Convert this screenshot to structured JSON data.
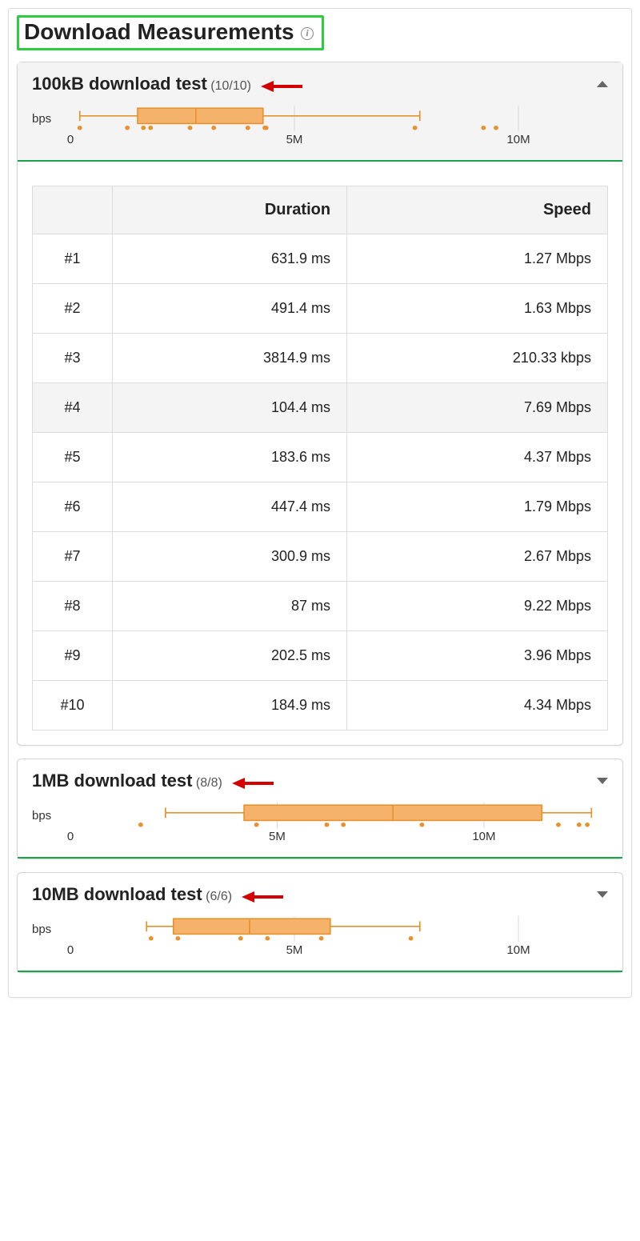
{
  "title": "Download Measurements",
  "tests": [
    {
      "title": "100kB download test",
      "count": "(10/10)",
      "expanded": true,
      "chart": {
        "ylabel": "bps",
        "ticks": [
          "0",
          "5M",
          "10M"
        ],
        "axis_max": 12,
        "box": {
          "low": 0.21,
          "q1": 1.5,
          "median": 2.8,
          "q3": 4.3,
          "high": 7.8
        },
        "points": [
          0.21,
          1.27,
          1.63,
          1.79,
          2.67,
          3.2,
          3.96,
          4.34,
          4.37,
          7.69,
          9.22,
          9.5
        ]
      },
      "table": {
        "columns": [
          "",
          "Duration",
          "Speed"
        ],
        "highlight_row": 3,
        "rows": [
          [
            "#1",
            "631.9 ms",
            "1.27 Mbps"
          ],
          [
            "#2",
            "491.4 ms",
            "1.63 Mbps"
          ],
          [
            "#3",
            "3814.9 ms",
            "210.33 kbps"
          ],
          [
            "#4",
            "104.4 ms",
            "7.69 Mbps"
          ],
          [
            "#5",
            "183.6 ms",
            "4.37 Mbps"
          ],
          [
            "#6",
            "447.4 ms",
            "1.79 Mbps"
          ],
          [
            "#7",
            "300.9 ms",
            "2.67 Mbps"
          ],
          [
            "#8",
            "87 ms",
            "9.22 Mbps"
          ],
          [
            "#9",
            "202.5 ms",
            "3.96 Mbps"
          ],
          [
            "#10",
            "184.9 ms",
            "4.34 Mbps"
          ]
        ]
      }
    },
    {
      "title": "1MB download test",
      "count": "(8/8)",
      "expanded": false,
      "chart": {
        "ylabel": "bps",
        "ticks": [
          "0",
          "5M",
          "10M"
        ],
        "axis_max": 13,
        "box": {
          "low": 2.3,
          "q1": 4.2,
          "median": 7.8,
          "q3": 11.4,
          "high": 12.6
        },
        "points": [
          1.7,
          4.5,
          6.2,
          6.6,
          8.5,
          11.8,
          12.3,
          12.5
        ]
      }
    },
    {
      "title": "10MB download test",
      "count": "(6/6)",
      "expanded": false,
      "chart": {
        "ylabel": "bps",
        "ticks": [
          "0",
          "5M",
          "10M"
        ],
        "axis_max": 12,
        "box": {
          "low": 1.7,
          "q1": 2.3,
          "median": 4.0,
          "q3": 5.8,
          "high": 7.8
        },
        "points": [
          1.8,
          2.4,
          3.8,
          4.4,
          5.6,
          7.6
        ]
      }
    }
  ],
  "chart_data": [
    {
      "type": "boxplot",
      "title": "100kB download test throughput distribution",
      "xlabel": "bps",
      "xticks": [
        0,
        5000000,
        10000000
      ],
      "box": {
        "min": 210000,
        "q1": 1500000,
        "median": 2800000,
        "q3": 4300000,
        "max": 7800000
      },
      "points_bps": [
        210330,
        1270000,
        1630000,
        1790000,
        2670000,
        3960000,
        4340000,
        4370000,
        7690000,
        9220000
      ]
    },
    {
      "type": "boxplot",
      "title": "1MB download test throughput distribution",
      "xlabel": "bps",
      "xticks": [
        0,
        5000000,
        10000000
      ],
      "box": {
        "min": 2300000,
        "q1": 4200000,
        "median": 7800000,
        "q3": 11400000,
        "max": 12600000
      },
      "points_bps": [
        1700000,
        4500000,
        6200000,
        6600000,
        8500000,
        11800000,
        12300000,
        12500000
      ]
    },
    {
      "type": "boxplot",
      "title": "10MB download test throughput distribution",
      "xlabel": "bps",
      "xticks": [
        0,
        5000000,
        10000000
      ],
      "box": {
        "min": 1700000,
        "q1": 2300000,
        "median": 4000000,
        "q3": 5800000,
        "max": 7800000
      },
      "points_bps": [
        1800000,
        2400000,
        3800000,
        4400000,
        5600000,
        7600000
      ]
    }
  ]
}
